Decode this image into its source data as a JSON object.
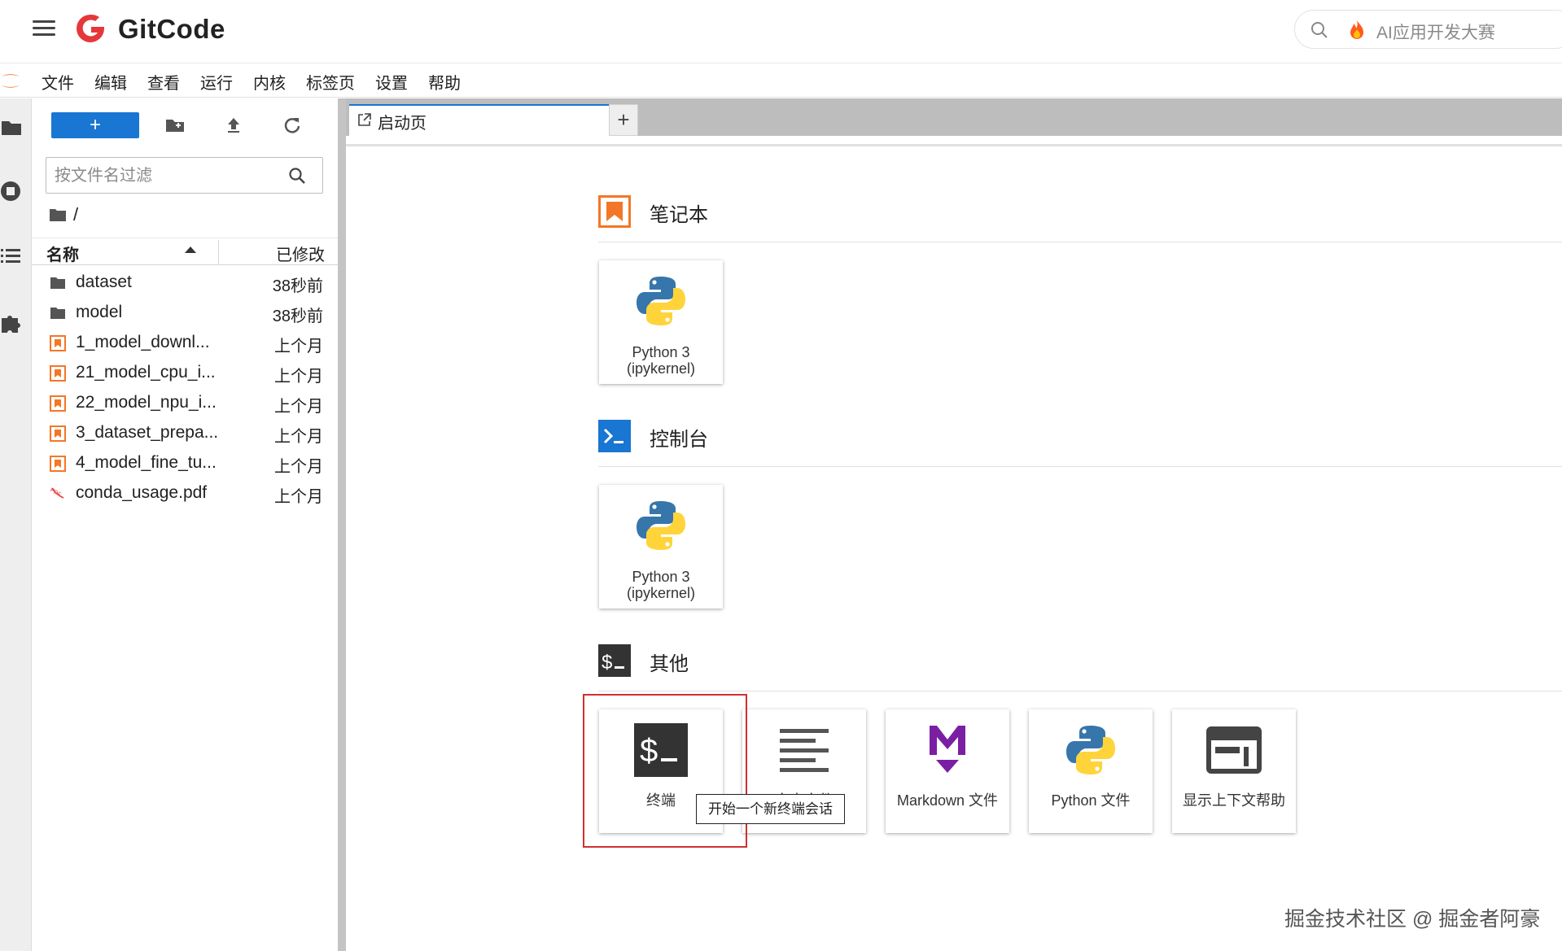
{
  "header": {
    "brand": "GitCode",
    "search_placeholder": "AI应用开发大赛"
  },
  "menu": [
    "文件",
    "编辑",
    "查看",
    "运行",
    "内核",
    "标签页",
    "设置",
    "帮助"
  ],
  "file_browser": {
    "new_button_label": "+",
    "filter_placeholder": "按文件名过滤",
    "breadcrumb": "/",
    "columns": {
      "name": "名称",
      "modified": "已修改"
    },
    "files": [
      {
        "name": "dataset",
        "modified": "38秒前",
        "type": "folder"
      },
      {
        "name": "model",
        "modified": "38秒前",
        "type": "folder"
      },
      {
        "name": "1_model_downl...",
        "modified": "上个月",
        "type": "notebook"
      },
      {
        "name": "21_model_cpu_i...",
        "modified": "上个月",
        "type": "notebook"
      },
      {
        "name": "22_model_npu_i...",
        "modified": "上个月",
        "type": "notebook"
      },
      {
        "name": "3_dataset_prepa...",
        "modified": "上个月",
        "type": "notebook"
      },
      {
        "name": "4_model_fine_tu...",
        "modified": "上个月",
        "type": "notebook"
      },
      {
        "name": "conda_usage.pdf",
        "modified": "上个月",
        "type": "pdf"
      }
    ]
  },
  "tabs": {
    "active_label": "启动页",
    "add_label": "+"
  },
  "launcher": {
    "notebook": {
      "title": "笔记本",
      "cards": [
        {
          "line1": "Python 3",
          "line2": "(ipykernel)",
          "icon": "python-icon"
        }
      ]
    },
    "console": {
      "title": "控制台",
      "cards": [
        {
          "line1": "Python 3",
          "line2": "(ipykernel)",
          "icon": "python-icon"
        }
      ]
    },
    "other": {
      "title": "其他",
      "cards": [
        {
          "label": "终端",
          "icon": "terminal-icon"
        },
        {
          "label": "文本文件",
          "icon": "text-file-icon"
        },
        {
          "label": "Markdown 文件",
          "icon": "markdown-icon"
        },
        {
          "label": "Python 文件",
          "icon": "python-icon"
        },
        {
          "label": "显示上下文帮助",
          "icon": "context-help-icon"
        }
      ]
    },
    "tooltip": "开始一个新终端会话"
  },
  "watermark": "掘金技术社区 @ 掘金者阿豪",
  "colors": {
    "accent": "#1976d2",
    "notebook_orange": "#f37726",
    "highlight_red": "#d32f2f",
    "markdown_purple": "#7b1fa2"
  }
}
